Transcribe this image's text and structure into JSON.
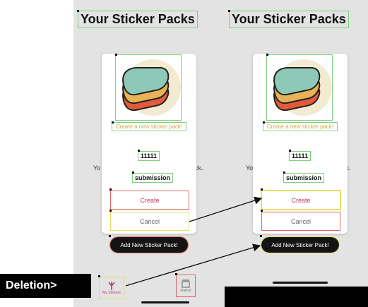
{
  "screen": {
    "title": "Your Sticker Packs",
    "dialog": {
      "create_label": "Create a new sticker pack!",
      "name_value": "11111",
      "description_value": "submission",
      "create_button": "Create",
      "cancel_button": "Cancel"
    },
    "bg_text_left": "Yo",
    "bg_text_right": "ck.",
    "add_button": "Add New Sticker Pack!",
    "tabs": {
      "my_stickers": "My Stickers",
      "market": "Market"
    }
  },
  "annotation": {
    "label": "Deletion>"
  },
  "icons": {
    "logo": "sticker-stack-logo",
    "my_stickers": "sticker-fork-icon",
    "market": "market-icon"
  },
  "colors": {
    "accent": "#c0395a",
    "button_dark": "#141414",
    "create_text": "#d9a24a",
    "highlight_green": "#7fd07f",
    "highlight_red": "#e06666",
    "highlight_yellow": "#e8e060"
  }
}
